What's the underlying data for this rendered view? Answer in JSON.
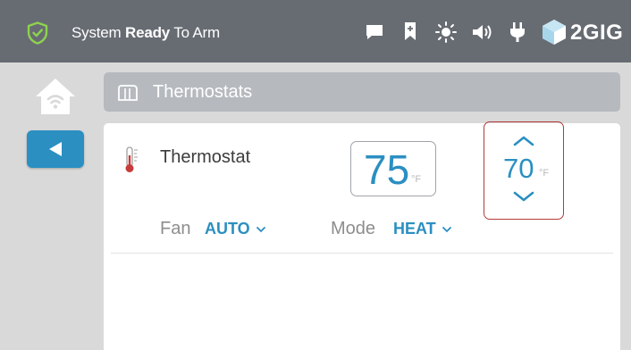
{
  "status_bar": {
    "status_prefix": "System",
    "status_bold": "Ready",
    "status_suffix": "To Arm",
    "icons": [
      "shield-check-icon",
      "message-icon",
      "bookmark-icon",
      "brightness-icon",
      "volume-icon",
      "power-plug-icon"
    ],
    "brand": "2GIG"
  },
  "nav": {
    "home_icon": "home-wifi-icon",
    "back_icon": "back-arrow-icon"
  },
  "header": {
    "title": "Thermostats"
  },
  "thermostat": {
    "name": "Thermostat",
    "current_temp": "75",
    "current_unit": "°F",
    "setpoint": "70",
    "setpoint_unit": "°F",
    "fan_label": "Fan",
    "fan_value": "AUTO",
    "mode_label": "Mode",
    "mode_value": "HEAT"
  },
  "colors": {
    "topbar": "#676c73",
    "accent_blue": "#2b8fc1",
    "highlight_red": "#b33a3a",
    "header_grey": "#b6babf"
  }
}
